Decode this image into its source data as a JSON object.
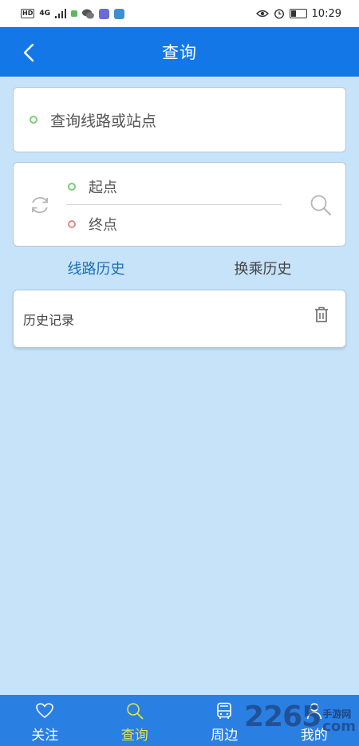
{
  "status_bar": {
    "left_chip": "HD",
    "signal": "4G",
    "time": "10:29"
  },
  "header": {
    "title": "查询"
  },
  "search": {
    "placeholder": "查询线路或站点"
  },
  "route": {
    "start_label": "起点",
    "end_label": "终点"
  },
  "tabs": [
    {
      "label": "线路历史",
      "active": true
    },
    {
      "label": "换乘历史",
      "active": false
    }
  ],
  "history": {
    "title": "历史记录"
  },
  "tabbar": [
    {
      "label": "关注",
      "icon": "heart-icon",
      "active": false
    },
    {
      "label": "查询",
      "icon": "search-icon",
      "active": true
    },
    {
      "label": "周边",
      "icon": "bus-icon",
      "active": false
    },
    {
      "label": "我的",
      "icon": "person-icon",
      "active": false
    }
  ],
  "watermark": {
    "number": "2265",
    "top_text": "手游网",
    "bottom_text": "com"
  },
  "colors": {
    "header": "#1477e8",
    "background": "#c6e3fa",
    "tabbar": "#2a7fe3",
    "active_tab_text": "#1d6fb5",
    "active_nav_text": "#e8e24b",
    "start_dot": "#7ccc7b",
    "end_dot": "#e08c88"
  }
}
